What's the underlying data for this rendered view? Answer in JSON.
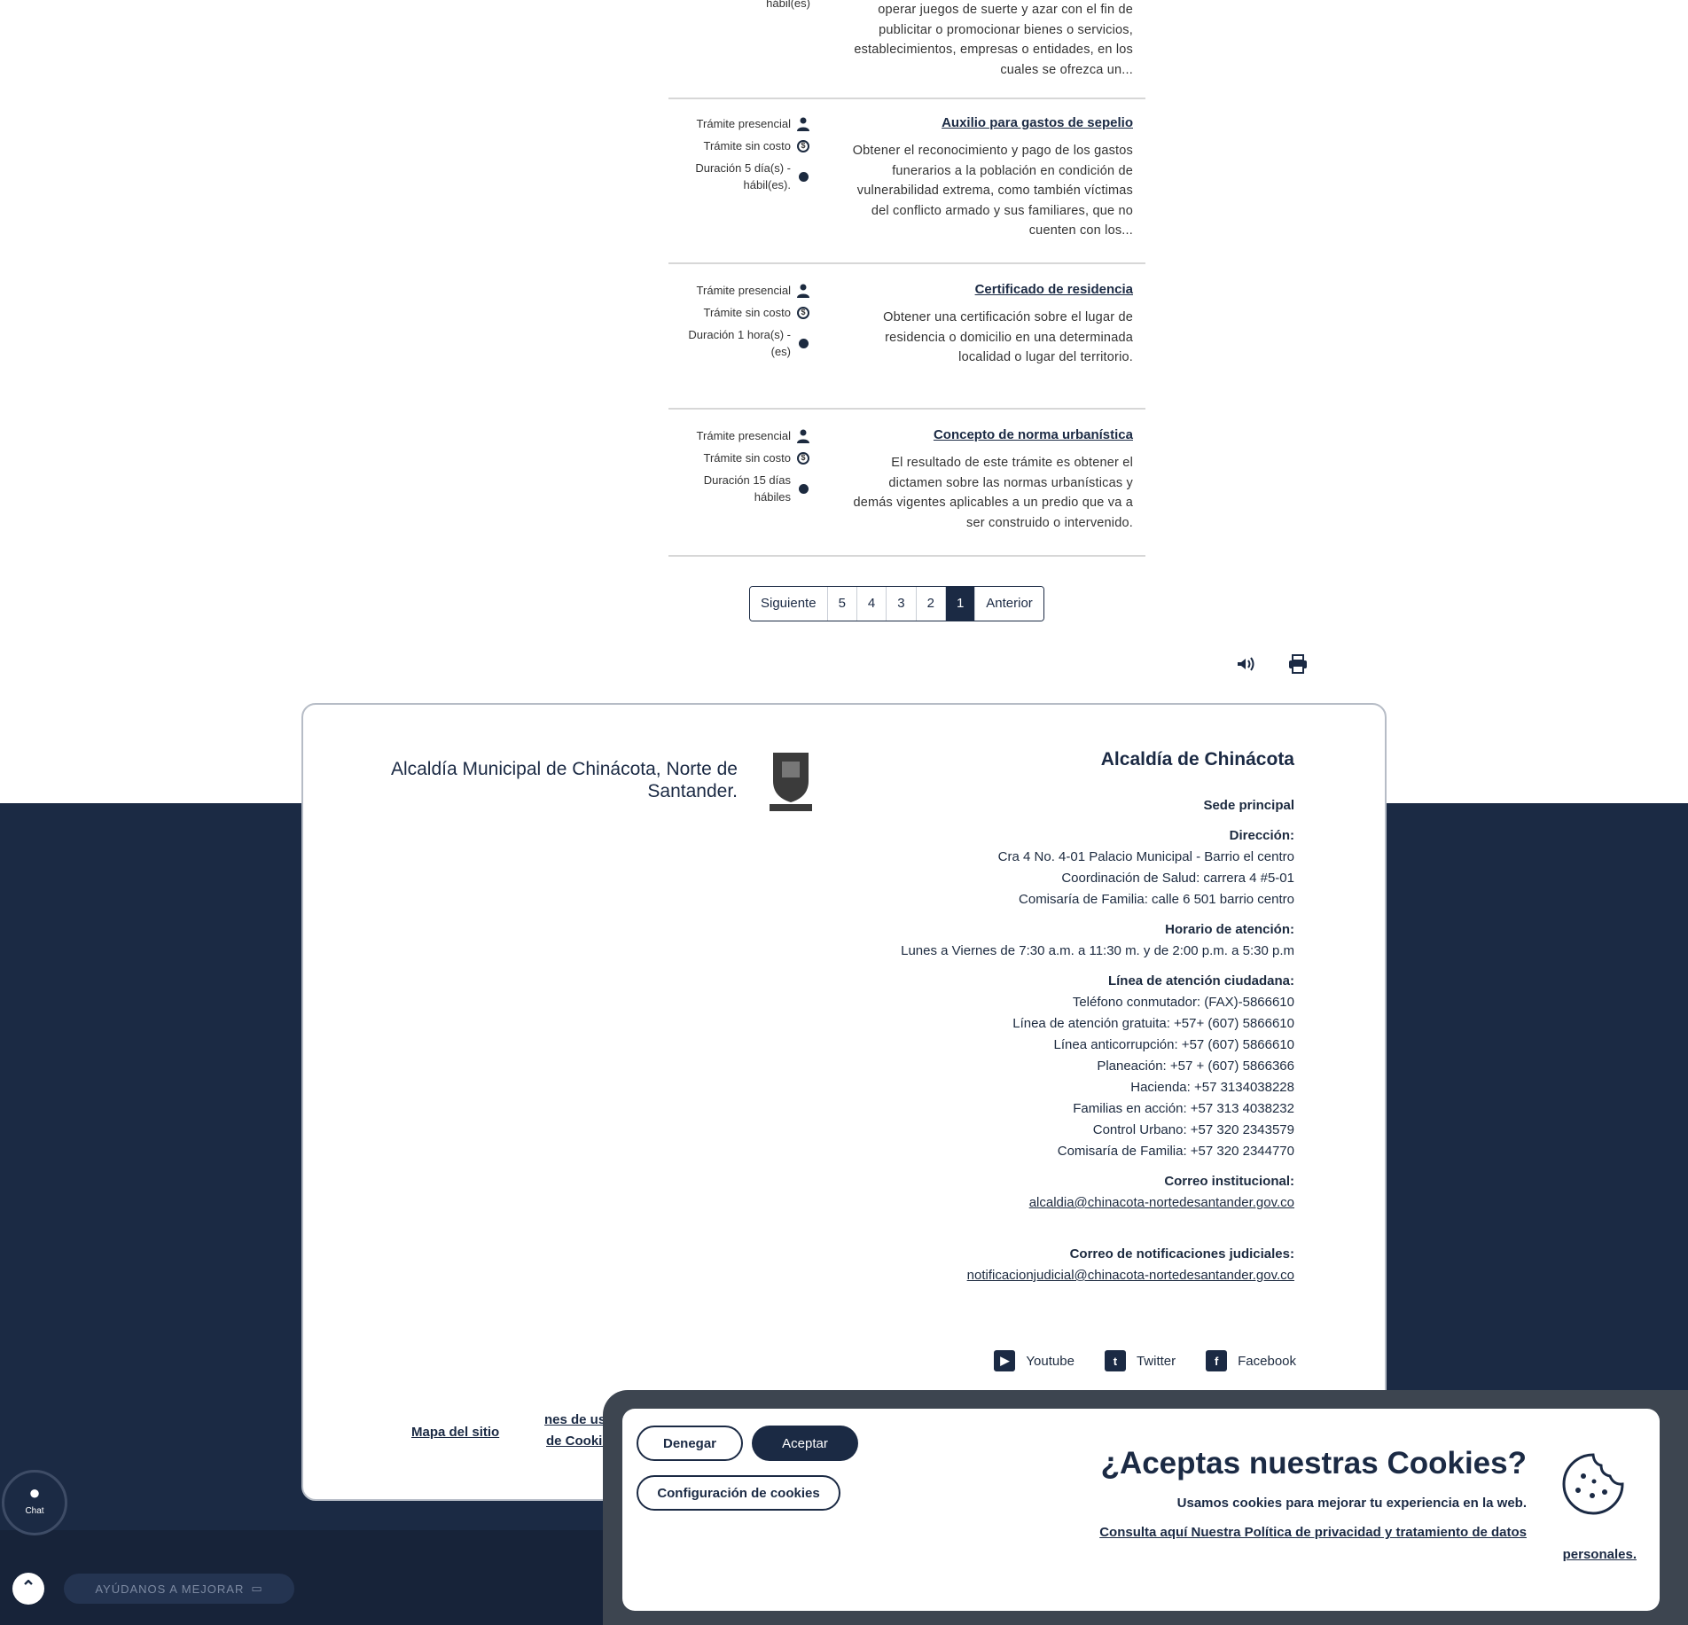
{
  "tramites": [
    {
      "description": "operar juegos de suerte y azar con el fin de publicitar o promocionar bienes o servicios, establecimientos, empresas o entidades, en los cuales se ofrezca un...",
      "meta": [
        "hábil(es)"
      ]
    },
    {
      "title": "Auxilio para gastos de sepelio",
      "description": "Obtener el reconocimiento y pago de los gastos funerarios a la población en condición de vulnerabilidad extrema, como también víctimas del conflicto armado y sus familiares, que no cuenten con los...",
      "meta": [
        "Trámite presencial",
        "Trámite sin costo",
        "Duración 5 día(s) - hábil(es)."
      ]
    },
    {
      "title": "Certificado de residencia",
      "description": "Obtener una certificación sobre el lugar de residencia o domicilio en una determinada localidad o lugar del territorio.",
      "meta": [
        "Trámite presencial",
        "Trámite sin costo",
        "Duración 1 hora(s) - (es)"
      ]
    },
    {
      "title": "Concepto de norma urbanística",
      "description": "El resultado de este trámite es obtener el dictamen sobre las normas urbanísticas y demás vigentes aplicables a un predio que va a ser construido o intervenido.",
      "meta": [
        "Trámite presencial",
        "Trámite sin costo",
        "Duración 15 días hábiles"
      ]
    }
  ],
  "pagination": {
    "prev": "Anterior",
    "pages": [
      "1",
      "2",
      "3",
      "4",
      "5"
    ],
    "current": "1",
    "next": "Siguiente"
  },
  "footer": {
    "title": "Alcaldía de Chinácota",
    "sede": "Sede principal",
    "address_label": "Dirección:",
    "address_lines": [
      "Cra 4 No. 4-01 Palacio Municipal - Barrio el centro",
      "Coordinación de Salud: carrera 4 #5-01",
      "Comisaría de Familia: calle 6 501 barrio centro"
    ],
    "hours_label": "Horario de atención:",
    "hours": "Lunes a Viernes de 7:30 a.m. a 11:30 m. y de 2:00 p.m. a 5:30 p.m",
    "phone_label": "Línea de atención ciudadana:",
    "phone_lines": [
      "Teléfono conmutador: (FAX)-5866610",
      "Línea de atención gratuita: +57+ (607) 5866610",
      "Línea anticorrupción: +57 (607) 5866610",
      "Planeación: +57 + (607) 5866366",
      "Hacienda: +57 3134038228",
      "Familias en acción: +57 313 4038232",
      "Control Urbano: +57 320 2343579",
      "Comisaría de Familia: +57 320 2344770"
    ],
    "email_label": "Correo institucional:",
    "email": "alcaldia@chinacota-nortedesantander.gov.co",
    "judicial_label": "Correo de notificaciones judiciales:",
    "judicial_email": "notificacionjudicial@chinacota-nortedesantander.gov.co",
    "alcaldia_name": "Alcaldía Municipal de Chinácota, Norte de Santander.",
    "socials": [
      "Facebook",
      "Twitter",
      "Youtube"
    ],
    "links": [
      "Mapa del sitio",
      "Políticas de Cookies",
      "Términos y condiciones de uso"
    ],
    "links_fragments": [
      "de Cookies",
      "nes de uso"
    ]
  },
  "cookie": {
    "title": "¿Aceptas nuestras Cookies?",
    "text": "Usamos cookies para mejorar tu experiencia en la web.",
    "link": "Consulta aquí Nuestra Política de privacidad y tratamiento de datos",
    "link_tail": "personales.",
    "accept": "Aceptar",
    "deny": "Denegar",
    "config": "Configuración de cookies"
  },
  "widgets": {
    "chat": "Chat",
    "help": "AYÚDANOS A MEJORAR"
  },
  "colors": {
    "navy": "#1b2a44",
    "white": "#ffffff"
  }
}
